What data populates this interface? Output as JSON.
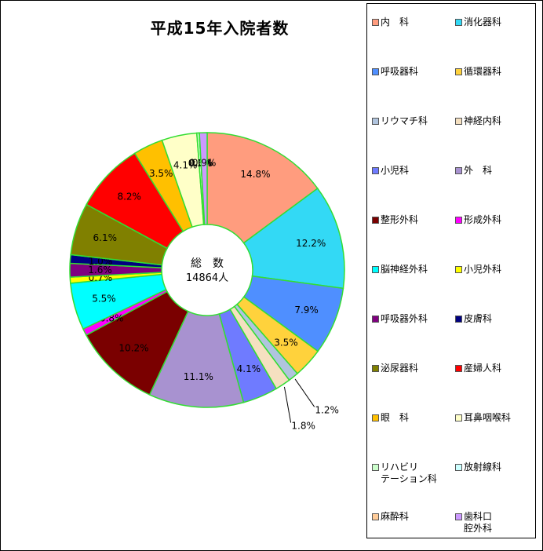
{
  "chart_data": {
    "type": "pie",
    "title": "平成15年入院者数",
    "center_label": "総　数",
    "center_value": "14864人",
    "categories": [
      "内　科",
      "消化器科",
      "呼吸器科",
      "循環器科",
      "リウマチ科",
      "神経内科",
      "小児科",
      "外　科",
      "整形外科",
      "形成外科",
      "脳神経外科",
      "小児外科",
      "呼吸器外科",
      "皮膚科",
      "泌尿器科",
      "産婦人科",
      "眼　科",
      "耳鼻咽喉科",
      "リハビリ\nテーション科",
      "放射線科",
      "麻酔科",
      "歯科口\n腔外科"
    ],
    "values": [
      14.8,
      12.2,
      7.9,
      3.5,
      1.2,
      1.8,
      4.1,
      11.1,
      10.2,
      0.8,
      5.5,
      0.7,
      1.6,
      1.0,
      6.1,
      8.2,
      3.5,
      4.1,
      0.3,
      0.0,
      0.0,
      0.9
    ],
    "data_labels": [
      "14.8%",
      "12.2%",
      "7.9%",
      "3.5%",
      "1.2%",
      "1.8%",
      "4.1%",
      "11.1%",
      "10.2%",
      "0.8%",
      "5.5%",
      "0.7%",
      "1.6%",
      "1.0%",
      "6.1%",
      "8.2%",
      "3.5%",
      "4.1%",
      "0.3%",
      "0.0%",
      "0.0%",
      "0.9%"
    ],
    "colors": [
      "#ff9c7e",
      "#33d9f5",
      "#4f8fff",
      "#ffd23c",
      "#b0c4de",
      "#f5e0c0",
      "#6f7bff",
      "#a892d0",
      "#7a0000",
      "#ff00ff",
      "#00ffff",
      "#ffff00",
      "#800080",
      "#000080",
      "#808000",
      "#ff0000",
      "#ffc000",
      "#ffffc8",
      "#ccffcc",
      "#ccffff",
      "#ffcc99",
      "#cc99ff"
    ],
    "legend_position": "right"
  }
}
